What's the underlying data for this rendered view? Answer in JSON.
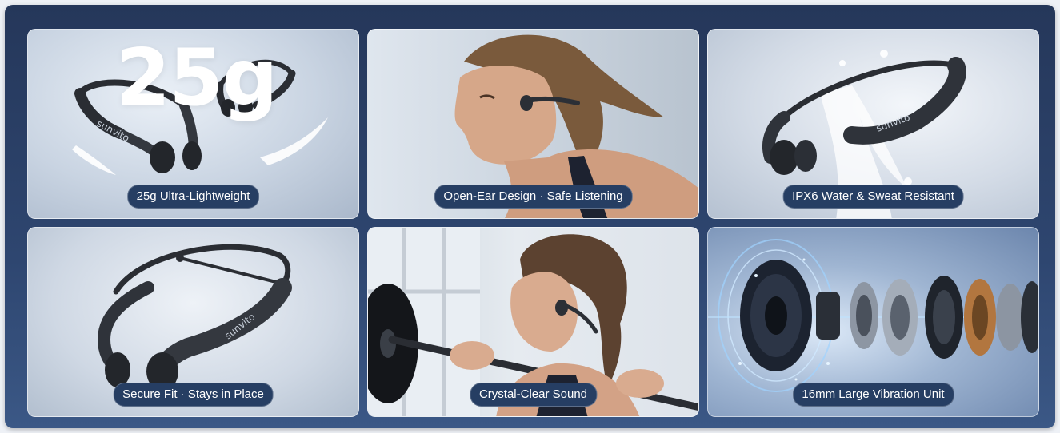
{
  "tiles": [
    {
      "id": "lightweight",
      "caption": "25g Ultra-Lightweight",
      "headline": "25g",
      "brand": "sunvito"
    },
    {
      "id": "open-ear",
      "caption": "Open-Ear Design · Safe Listening"
    },
    {
      "id": "waterproof",
      "caption": "IPX6 Water & Sweat Resistant",
      "brand": "sunvito"
    },
    {
      "id": "secure-fit",
      "caption": "Secure Fit · Stays in Place",
      "brand": "sunvito"
    },
    {
      "id": "sound",
      "caption": "Crystal-Clear Sound"
    },
    {
      "id": "driver",
      "caption": "16mm Large Vibration Unit"
    }
  ],
  "colors": {
    "frame": "#2b4169",
    "label_bg": "#263e63",
    "label_text": "#ffffff"
  }
}
